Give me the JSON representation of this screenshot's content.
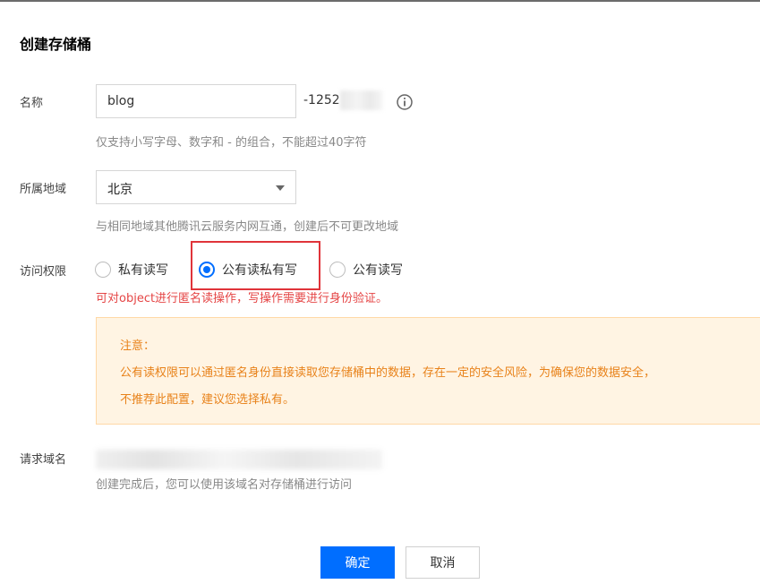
{
  "dialog": {
    "title": "创建存储桶"
  },
  "name": {
    "label": "名称",
    "value": "blog",
    "suffix": "-1252",
    "hint": "仅支持小写字母、数字和 - 的组合，不能超过40字符"
  },
  "region": {
    "label": "所属地域",
    "selected": "北京",
    "hint": "与相同地域其他腾讯云服务内网互通，创建后不可更改地域"
  },
  "access": {
    "label": "访问权限",
    "options": [
      {
        "label": "私有读写",
        "checked": false
      },
      {
        "label": "公有读私有写",
        "checked": true
      },
      {
        "label": "公有读写",
        "checked": false
      }
    ],
    "warning": "可对object进行匿名读操作，写操作需要进行身份验证。"
  },
  "notice": {
    "heading": "注意：",
    "line1": "公有读权限可以通过匿名身份直接读取您存储桶中的数据，存在一定的安全风险，为确保您的数据安全，",
    "line2": "不推荐此配置，建议您选择私有。"
  },
  "domain": {
    "label": "请求域名",
    "hint": "创建完成后，您可以使用该域名对存储桶进行访问"
  },
  "buttons": {
    "confirm": "确定",
    "cancel": "取消"
  },
  "colors": {
    "primary": "#006eff",
    "warning": "#e54545",
    "notice_text": "#e8821a",
    "highlight": "#e0343a"
  }
}
